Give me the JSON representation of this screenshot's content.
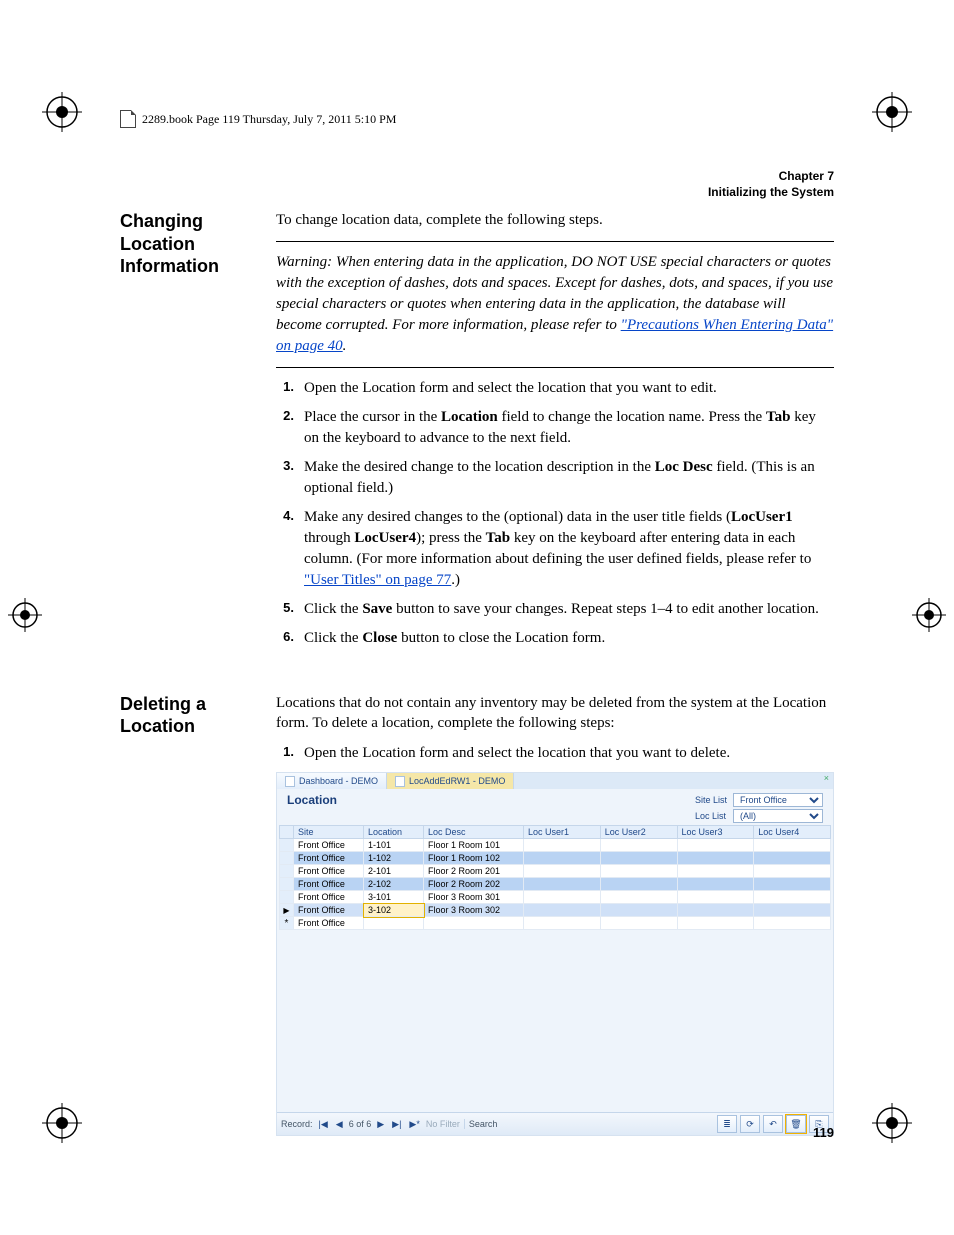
{
  "headerline": "2289.book  Page 119  Thursday, July 7, 2011  5:10 PM",
  "chapter": {
    "line1": "Chapter 7",
    "line2": "Initializing the System"
  },
  "sec1": {
    "heading": "Changing Location Information",
    "intro": "To change location data, complete the following steps.",
    "warning_prefix": "Warning:   When entering data in the application, DO NOT USE special characters or quotes with the exception of dashes, dots and spaces. Except for dashes, dots, and spaces, if you use special characters or quotes when entering data in the application, the database will become corrupted. For more information, please refer to ",
    "warning_link": "\"Precautions When Entering Data\" on page 40",
    "warning_suffix": ".",
    "steps": [
      {
        "n": "1.",
        "html": "Open the Location form and select the location that you want to edit."
      },
      {
        "n": "2.",
        "html": "Place the cursor in the <span class=b>Location</span> field to change the location name. Press the <span class=b>Tab</span> key on the keyboard to advance to the next field."
      },
      {
        "n": "3.",
        "html": "Make the desired change to the location description in the <span class=b>Loc Desc</span> field. (This is an optional field.)"
      },
      {
        "n": "4.",
        "html": "Make any desired changes to the (optional) data in the user title fields (<span class=b>LocUser1</span> through <span class=b>LocUser4</span>); press the <span class=b>Tab</span> key on the keyboard after entering data in each column. (For more information about defining the user defined fields, please refer to <a class=link data-name=user-titles-link data-interactable=true>\"User Titles\" on page 77</a>.)"
      },
      {
        "n": "5.",
        "html": "Click the <span class=b>Save</span> button to save your changes. Repeat steps 1–4 to edit another location."
      },
      {
        "n": "6.",
        "html": "Click the <span class=b>Close</span> button to close the Location form."
      }
    ]
  },
  "sec2": {
    "heading": "Deleting a Location",
    "intro": "Locations that do not contain any inventory may be deleted from the system at the Location form. To delete a location, complete the following steps:",
    "step1": {
      "n": "1.",
      "text": "Open the Location form and select the location that you want to delete."
    }
  },
  "shot": {
    "tabs": [
      {
        "label": "Dashboard - DEMO",
        "active": false
      },
      {
        "label": "LocAddEdRW1 - DEMO",
        "active": true
      }
    ],
    "title": "Location",
    "filters": {
      "siteListLabel": "Site List",
      "siteListValue": "Front Office",
      "locListLabel": "Loc List",
      "locListValue": "(All)"
    },
    "columns": [
      "Site",
      "Location",
      "Loc Desc",
      "Loc User1",
      "Loc User2",
      "Loc User3",
      "Loc User4"
    ],
    "rows": [
      {
        "cls": "",
        "site": "Front Office",
        "loc": "1-101",
        "desc": "Floor 1 Room 101"
      },
      {
        "cls": "hl",
        "site": "Front Office",
        "loc": "1-102",
        "desc": "Floor 1 Room 102"
      },
      {
        "cls": "",
        "site": "Front Office",
        "loc": "2-101",
        "desc": "Floor 2 Room 201"
      },
      {
        "cls": "hl",
        "site": "Front Office",
        "loc": "2-102",
        "desc": "Floor 2 Room 202"
      },
      {
        "cls": "",
        "site": "Front Office",
        "loc": "3-101",
        "desc": "Floor 3 Room 301"
      },
      {
        "cls": "hl2 focus",
        "site": "Front Office",
        "loc": "3-102",
        "desc": "Floor 3 Room 302",
        "edit": true
      },
      {
        "cls": "star",
        "site": "Front Office",
        "loc": "",
        "desc": ""
      }
    ],
    "status": {
      "record": "Record:",
      "navFirst": "|◀",
      "navPrev": "◀",
      "pos": "6 of 6",
      "navNext": "▶",
      "navLast": "▶|",
      "navNew": "▶*",
      "noFilter": "No Filter",
      "search": "Search"
    }
  },
  "pagenum": "119"
}
